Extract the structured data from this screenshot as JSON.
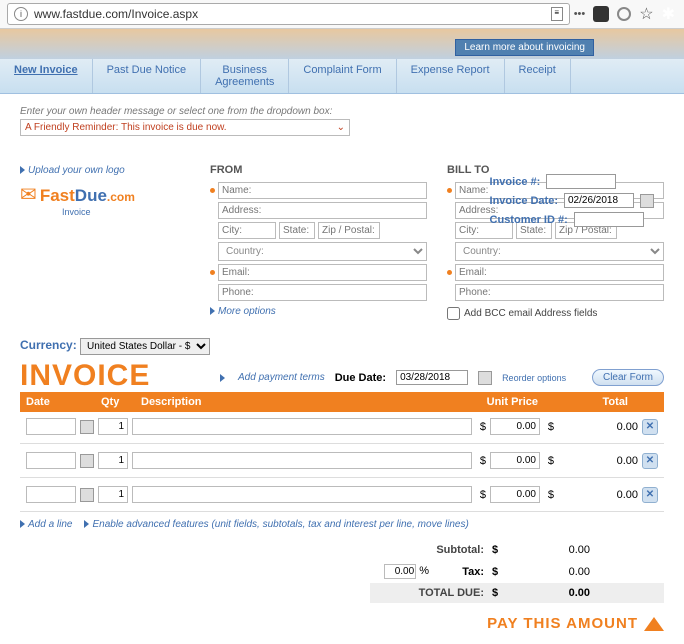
{
  "browser": {
    "url": "www.fastdue.com/Invoice.aspx",
    "pill": "Learn more about invoicing"
  },
  "tabs": [
    "New Invoice",
    "Past Due Notice",
    "Business\nAgreements",
    "Complaint Form",
    "Expense Report",
    "Receipt"
  ],
  "header_hint": "Enter your own header message or select one from the dropdown box:",
  "header_value": "A Friendly Reminder: This invoice is due now.",
  "meta": {
    "invoice_no": "Invoice #:",
    "invoice_date": "Invoice Date:",
    "invoice_date_val": "02/26/2018",
    "customer_id": "Customer ID #:"
  },
  "logo": {
    "upload": "Upload your own logo",
    "fast": "Fast",
    "due": "Due",
    "com": ".com",
    "sub": "Invoice"
  },
  "from": {
    "title": "FROM",
    "name": "Name:",
    "address": "Address:",
    "city": "City:",
    "state": "State:",
    "zip": "Zip / Postal:",
    "country": "Country:",
    "email": "Email:",
    "phone": "Phone:",
    "more": "More options"
  },
  "bill": {
    "title": "BILL TO",
    "bcc": "Add BCC email Address fields"
  },
  "currency": {
    "label": "Currency:",
    "value": "United States Dollar - $"
  },
  "invoice_title": "INVOICE",
  "add_terms": "Add payment terms",
  "due_date": {
    "label": "Due Date:",
    "value": "03/28/2018"
  },
  "reorder": "Reorder options",
  "clear": "Clear Form",
  "columns": {
    "date": "Date",
    "qty": "Qty",
    "desc": "Description",
    "up": "Unit Price",
    "tot": "Total"
  },
  "rows": [
    {
      "qty": "1",
      "up": "0.00",
      "tot": "0.00"
    },
    {
      "qty": "1",
      "up": "0.00",
      "tot": "0.00"
    },
    {
      "qty": "1",
      "up": "0.00",
      "tot": "0.00"
    }
  ],
  "add_line": "Add a line",
  "enable_adv": "Enable advanced features (unit fields, subtotals, tax and interest per line, move lines)",
  "totals": {
    "subtotal_lbl": "Subtotal:",
    "subtotal": "0.00",
    "tax_lbl": "Tax:",
    "tax_pct": "0.00",
    "tax": "0.00",
    "due_lbl": "TOTAL DUE:",
    "due": "0.00",
    "dollar": "$",
    "pct": "%"
  },
  "pay": "PAY THIS AMOUNT"
}
